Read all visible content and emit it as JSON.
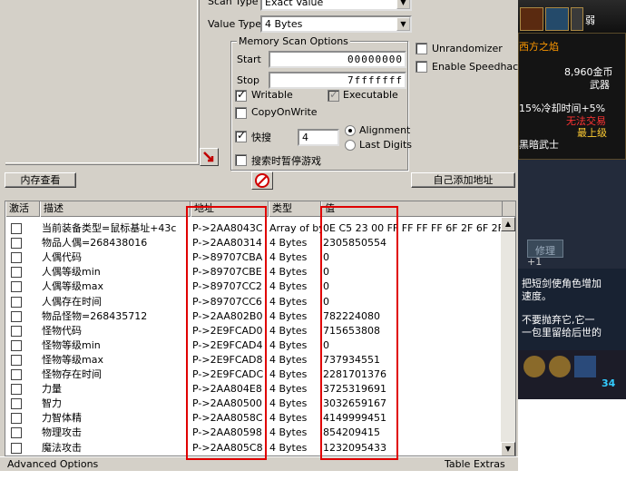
{
  "scan": {
    "scan_type_label": "Scan Type",
    "scan_type_value": "Exact Value",
    "value_type_label": "Value Type",
    "value_type_value": "4 Bytes"
  },
  "memory_options": {
    "legend": "Memory Scan Options",
    "start_label": "Start",
    "start_value": "00000000",
    "stop_label": "Stop",
    "stop_value": "7fffffff",
    "writable_label": "Writable",
    "executable_label": "Executable",
    "copyonwrite_label": "CopyOnWrite",
    "fast_label": "快搜",
    "fast_value": "4",
    "alignment_label": "Alignment",
    "lastdigits_label": "Last Digits",
    "pause_label": "搜索时暂停游戏"
  },
  "right_options": {
    "unrandomizer_label": "Unrandomizer",
    "speedhack_label": "Enable Speedhack"
  },
  "buttons": {
    "memory_view": "内存查看",
    "add_address": "自己添加地址"
  },
  "table": {
    "columns": [
      "激活",
      "描述",
      "地址",
      "类型",
      "值"
    ],
    "rows": [
      {
        "desc": "当前装备类型=鼠标基址+43c",
        "addr": "P->2AA8043C",
        "type": "Array of byte",
        "value": "0E C5 23 00 FF FF FF FF 6F 2F 6F 2F"
      },
      {
        "desc": "物品人偶=268438016",
        "addr": "P->2AA80314",
        "type": "4 Bytes",
        "value": "2305850554"
      },
      {
        "desc": "人偶代码",
        "addr": "P->89707CBA",
        "type": "4 Bytes",
        "value": "0"
      },
      {
        "desc": "人偶等级min",
        "addr": "P->89707CBE",
        "type": "4 Bytes",
        "value": "0"
      },
      {
        "desc": "人偶等级max",
        "addr": "P->89707CC2",
        "type": "4 Bytes",
        "value": "0"
      },
      {
        "desc": "人偶存在时间",
        "addr": "P->89707CC6",
        "type": "4 Bytes",
        "value": "0"
      },
      {
        "desc": "物品怪物=268435712",
        "addr": "P->2AA802B0",
        "type": "4 Bytes",
        "value": "782224080"
      },
      {
        "desc": "怪物代码",
        "addr": "P->2E9FCAD0",
        "type": "4 Bytes",
        "value": "715653808"
      },
      {
        "desc": "怪物等级min",
        "addr": "P->2E9FCAD4",
        "type": "4 Bytes",
        "value": "0"
      },
      {
        "desc": "怪物等级max",
        "addr": "P->2E9FCAD8",
        "type": "4 Bytes",
        "value": "737934551"
      },
      {
        "desc": "怪物存在时间",
        "addr": "P->2E9FCADC",
        "type": "4 Bytes",
        "value": "2281701376"
      },
      {
        "desc": "力量",
        "addr": "P->2AA804E8",
        "type": "4 Bytes",
        "value": "3725319691"
      },
      {
        "desc": "智力",
        "addr": "P->2AA80500",
        "type": "4 Bytes",
        "value": "3032659167"
      },
      {
        "desc": "力智体精",
        "addr": "P->2AA8058C",
        "type": "4 Bytes",
        "value": "4149999451"
      },
      {
        "desc": "物理攻击",
        "addr": "P->2AA80598",
        "type": "4 Bytes",
        "value": "854209415"
      },
      {
        "desc": "魔法攻击",
        "addr": "P->2AA805C8",
        "type": "4 Bytes",
        "value": "1232095433"
      }
    ]
  },
  "status": {
    "advanced": "Advanced Options",
    "extras": "Table Extras"
  },
  "game": {
    "name_tag": "弱",
    "title": "西方之焰",
    "gold": "8,960金币",
    "weapon": "武器",
    "cooldown": "15%冷却时间+5%",
    "untradeable": "无法交易",
    "grade": "最上级",
    "class": "黑暗武士",
    "repair": "修理",
    "plus": "+1",
    "desc1": "把短剑使角色增加",
    "desc2": "速度。",
    "desc3": "不要抛弃它,它一",
    "desc4": "一包里留给后世的",
    "num": "34"
  },
  "colors": {
    "window_bg": "#d4d0c8",
    "highlight_red": "#e00000",
    "game_gold": "#ffcc33"
  }
}
